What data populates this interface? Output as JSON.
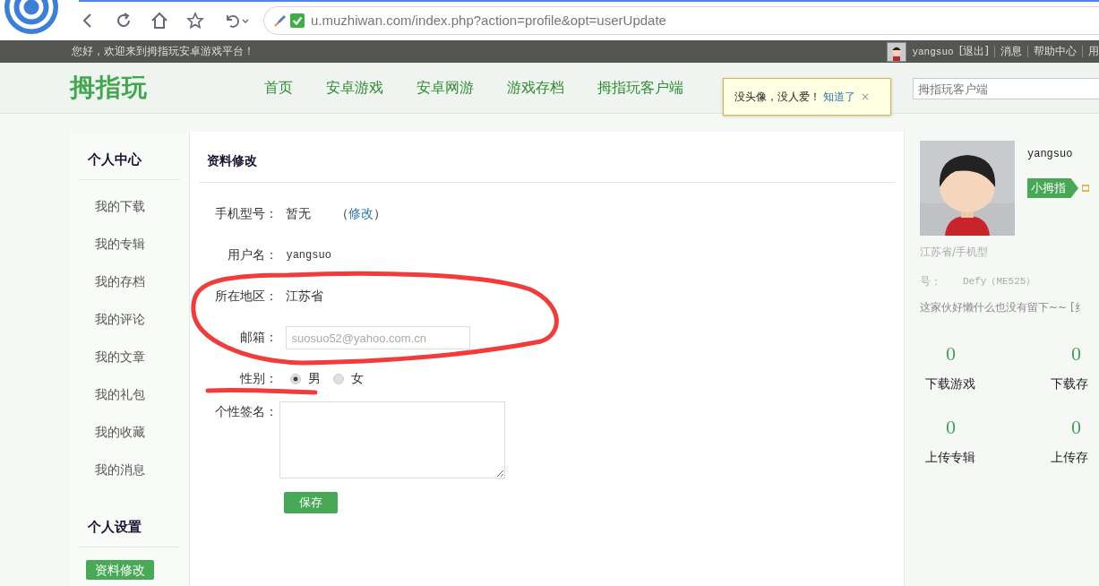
{
  "browser": {
    "url": "u.muzhiwan.com/index.php?action=profile&opt=userUpdate"
  },
  "top_bar": {
    "welcome": "您好，欢迎来到拇指玩安卓游戏平台！",
    "username": "yangsuo",
    "logout": "[退出]",
    "links": [
      "消息",
      "帮助中心",
      "用"
    ]
  },
  "header": {
    "logo": "拇指玩",
    "nav": [
      "首页",
      "安卓游戏",
      "安卓网游",
      "游戏存档",
      "拇指玩客户端"
    ],
    "search": {
      "placeholder": "拇指玩客户端"
    }
  },
  "tooltip": {
    "message": "没头像，没人爱！",
    "link": "知道了",
    "close": "×"
  },
  "sidebar": {
    "sections": [
      {
        "title": "个人中心",
        "items": [
          {
            "label": "我的下载",
            "selected": false
          },
          {
            "label": "我的专辑",
            "selected": false
          },
          {
            "label": "我的存档",
            "selected": false
          },
          {
            "label": "我的评论",
            "selected": false
          },
          {
            "label": "我的文章",
            "selected": false
          },
          {
            "label": "我的礼包",
            "selected": false
          },
          {
            "label": "我的收藏",
            "selected": false
          },
          {
            "label": "我的消息",
            "selected": false
          }
        ]
      },
      {
        "title": "个人设置",
        "items": [
          {
            "label": "资料修改",
            "selected": true
          }
        ]
      }
    ]
  },
  "form": {
    "title": "资料修改",
    "fields": [
      {
        "kind": "static",
        "label": "手机型号：",
        "value": "暂无",
        "link": {
          "before": "（",
          "text": "修改",
          "after": "）"
        }
      },
      {
        "kind": "static",
        "label": "用户名：",
        "value": "yangsuo"
      },
      {
        "kind": "static",
        "label": "所在地区：",
        "value": "江苏省"
      },
      {
        "kind": "input",
        "label": "邮箱：",
        "value": "suosuo52@yahoo.com.cn"
      },
      {
        "kind": "radio",
        "label": "性别：",
        "options": [
          {
            "label": "男",
            "selected": true
          },
          {
            "label": "女",
            "selected": false
          }
        ]
      },
      {
        "kind": "textarea",
        "label": "个性签名："
      }
    ],
    "save": "保存"
  },
  "profile": {
    "username": "yangsuo",
    "badge": "小拇指",
    "location": "江苏省/手机型",
    "phone_label": "号：",
    "phone": "Defy（ME525）",
    "bio": "这家伙好懒什么也没有留下~~ [纟",
    "stats": [
      {
        "value": "0",
        "label": "下载游戏"
      },
      {
        "value": "0",
        "label": "下载存"
      },
      {
        "value": "0",
        "label": "上传专辑"
      },
      {
        "value": "0",
        "label": "上传存"
      }
    ]
  }
}
